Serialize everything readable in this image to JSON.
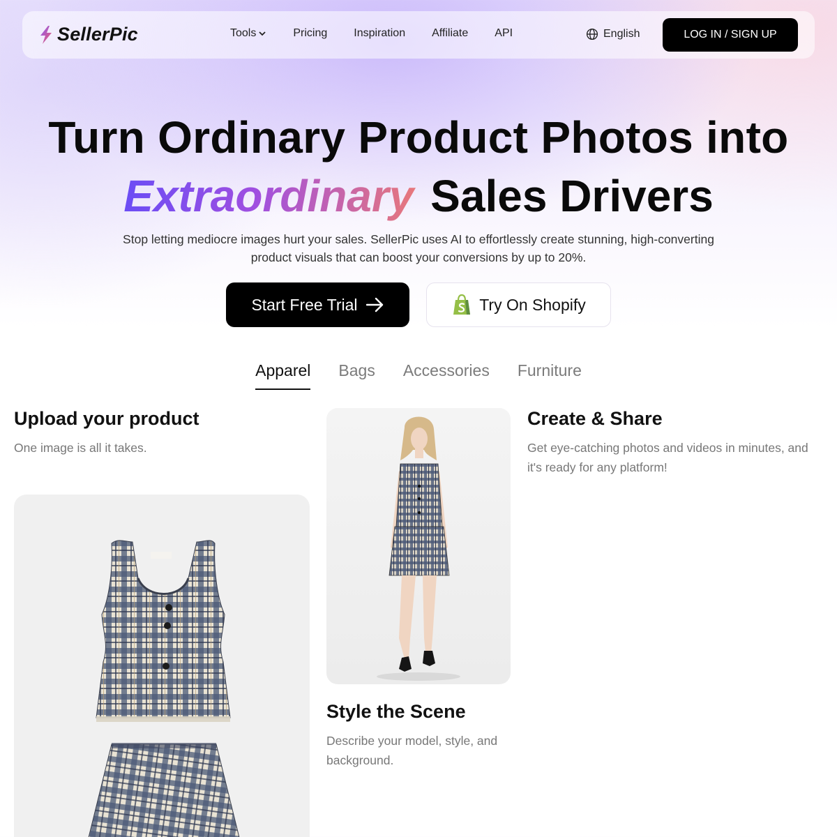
{
  "nav": {
    "logo_text": "SellerPic",
    "links": [
      {
        "label": "Tools",
        "has_dropdown": true
      },
      {
        "label": "Pricing"
      },
      {
        "label": "Inspiration"
      },
      {
        "label": "Affiliate"
      },
      {
        "label": "API"
      }
    ],
    "language": "English",
    "login_label": "LOG IN / SIGN UP"
  },
  "hero": {
    "line1": "Turn Ordinary Product Photos into",
    "highlight": "Extraordinary",
    "line2_rest": "Sales Drivers",
    "subtitle": "Stop letting mediocre images hurt your sales. SellerPic uses AI to effortlessly create stunning, high-converting product visuals that can boost your conversions by up to 20%.",
    "cta_primary": "Start Free Trial",
    "cta_secondary": "Try On Shopify"
  },
  "tabs": [
    {
      "label": "Apparel",
      "active": true
    },
    {
      "label": "Bags",
      "active": false
    },
    {
      "label": "Accessories",
      "active": false
    },
    {
      "label": "Furniture",
      "active": false
    }
  ],
  "steps": {
    "upload": {
      "title": "Upload your product",
      "desc": "One image is all it takes."
    },
    "style": {
      "title": "Style the Scene",
      "desc": "Describe your model, style, and background."
    },
    "create": {
      "title": "Create & Share",
      "desc": "Get eye-catching photos and videos in minutes, and it's ready for any platform!"
    }
  },
  "colors": {
    "accent_gradient": [
      "#6b4df5",
      "#a04fe0",
      "#e8787a"
    ],
    "button_dark": "#000000",
    "shopify_green": "#95bf47"
  }
}
